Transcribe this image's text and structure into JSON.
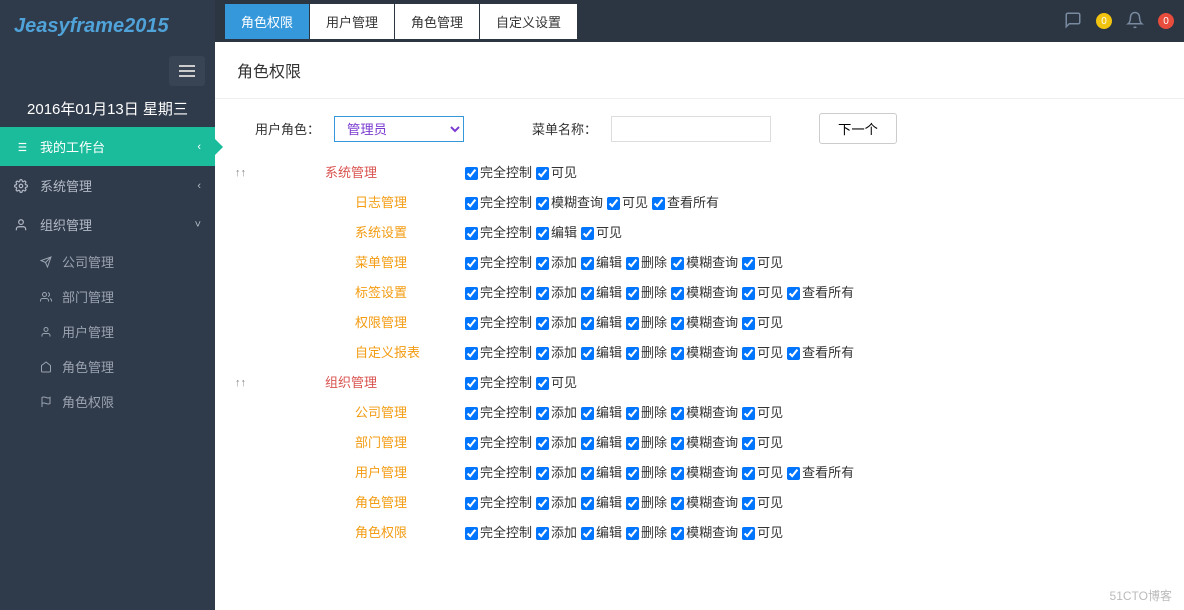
{
  "brand": "Jeasyframe2015",
  "date_line": "2016年01月13日 星期三",
  "notif": {
    "mail_count": "0",
    "bell_count": "0"
  },
  "sidebar": {
    "items": [
      {
        "label": "我的工作台",
        "icon": "list",
        "active": true,
        "chev": "‹"
      },
      {
        "label": "系统管理",
        "icon": "gear",
        "active": false,
        "chev": "‹"
      },
      {
        "label": "组织管理",
        "icon": "user",
        "active": false,
        "chev": "˅",
        "children": [
          {
            "label": "公司管理",
            "icon": "plane"
          },
          {
            "label": "部门管理",
            "icon": "users"
          },
          {
            "label": "用户管理",
            "icon": "person"
          },
          {
            "label": "角色管理",
            "icon": "home"
          },
          {
            "label": "角色权限",
            "icon": "flag"
          }
        ]
      }
    ]
  },
  "tabs": [
    {
      "label": "角色权限",
      "active": true
    },
    {
      "label": "用户管理",
      "active": false
    },
    {
      "label": "角色管理",
      "active": false
    },
    {
      "label": "自定义设置",
      "active": false
    }
  ],
  "page_title": "角色权限",
  "filters": {
    "role_label": "用户角色：",
    "role_value": "管理员",
    "menu_name_label": "菜单名称：",
    "menu_name_value": "",
    "next_btn": "下一个"
  },
  "perm_groups": [
    {
      "label": "系统管理",
      "perms": [
        "完全控制",
        "可见"
      ],
      "children": [
        {
          "label": "日志管理",
          "perms": [
            "完全控制",
            "模糊查询",
            "可见",
            "查看所有"
          ]
        },
        {
          "label": "系统设置",
          "perms": [
            "完全控制",
            "编辑",
            "可见"
          ]
        },
        {
          "label": "菜单管理",
          "perms": [
            "完全控制",
            "添加",
            "编辑",
            "删除",
            "模糊查询",
            "可见"
          ]
        },
        {
          "label": "标签设置",
          "perms": [
            "完全控制",
            "添加",
            "编辑",
            "删除",
            "模糊查询",
            "可见",
            "查看所有"
          ]
        },
        {
          "label": "权限管理",
          "perms": [
            "完全控制",
            "添加",
            "编辑",
            "删除",
            "模糊查询",
            "可见"
          ]
        },
        {
          "label": "自定义报表",
          "perms": [
            "完全控制",
            "添加",
            "编辑",
            "删除",
            "模糊查询",
            "可见",
            "查看所有"
          ]
        }
      ]
    },
    {
      "label": "组织管理",
      "perms": [
        "完全控制",
        "可见"
      ],
      "children": [
        {
          "label": "公司管理",
          "perms": [
            "完全控制",
            "添加",
            "编辑",
            "删除",
            "模糊查询",
            "可见"
          ]
        },
        {
          "label": "部门管理",
          "perms": [
            "完全控制",
            "添加",
            "编辑",
            "删除",
            "模糊查询",
            "可见"
          ]
        },
        {
          "label": "用户管理",
          "perms": [
            "完全控制",
            "添加",
            "编辑",
            "删除",
            "模糊查询",
            "可见",
            "查看所有"
          ]
        },
        {
          "label": "角色管理",
          "perms": [
            "完全控制",
            "添加",
            "编辑",
            "删除",
            "模糊查询",
            "可见"
          ]
        },
        {
          "label": "角色权限",
          "perms": [
            "完全控制",
            "添加",
            "编辑",
            "删除",
            "模糊查询",
            "可见"
          ]
        }
      ]
    }
  ],
  "watermark": "51CTO博客"
}
